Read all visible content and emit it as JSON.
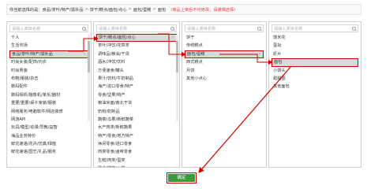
{
  "breadcrumb": {
    "prefix": "你当前选择的是：",
    "path": [
      "食品/茶叶/特产/滋补品",
      "饼干/糕点/面包/点心",
      "面包/蛋糕",
      "面包"
    ],
    "separator": ">",
    "hint": "（商品上架后不可修改，请谨慎选择）"
  },
  "columns": [
    {
      "placeholder": "请输入类目名称",
      "items": [
        {
          "label": "个人",
          "arrow": false
        },
        {
          "label": "生活市场",
          "arrow": false
        },
        {
          "label": "食品/茶叶/特产/滋补品",
          "arrow": true,
          "selected": true
        },
        {
          "label": "时尚女装/配饰/内衣",
          "arrow": false
        },
        {
          "label": "时尚男装",
          "arrow": false
        },
        {
          "label": "布鞋/服装/杂志",
          "arrow": false
        },
        {
          "label": "数码配件",
          "arrow": false
        },
        {
          "label": "数码相机/摄像机/单反/器材",
          "arrow": false
        },
        {
          "label": "重要/重要/桌子家装/服装",
          "arrow": false
        },
        {
          "label": "网络服务/电脑软件/网店装修",
          "arrow": false
        },
        {
          "label": "网游API",
          "arrow": false
        },
        {
          "label": "玩具/模型/动漫/早教/益智",
          "arrow": false
        },
        {
          "label": "海品业务特价",
          "arrow": false
        },
        {
          "label": "鲜花速递/花卉/仿真/绿植",
          "arrow": false
        },
        {
          "label": "鲜花速递/园艺/礼品/服务",
          "arrow": false
        }
      ]
    },
    {
      "placeholder": "请输入类目名称",
      "items": [
        {
          "label": "饼干/糕点/面包/点心",
          "arrow": true,
          "selected": true
        },
        {
          "label": "茶叶/冲饮/花草茶",
          "arrow": false
        },
        {
          "label": "调味品/粮油/干货",
          "arrow": false
        },
        {
          "label": "酒水/冲饮/饮料",
          "arrow": false
        },
        {
          "label": "方便速食/罐头",
          "arrow": false
        },
        {
          "label": "果汁/饮料/牛奶制品",
          "arrow": false
        },
        {
          "label": "海产/进口零食/特产",
          "arrow": false
        },
        {
          "label": "零食/坚果/特产",
          "arrow": false
        },
        {
          "label": "粮油米面/南北干货",
          "arrow": false
        },
        {
          "label": "奶粉/奶制品",
          "arrow": false
        },
        {
          "label": "蔬菜/瓜果/新鲜蔬菜",
          "arrow": false
        },
        {
          "label": "水产肉类/新鲜蔬果",
          "arrow": false
        },
        {
          "label": "特产/零食/地方特产",
          "arrow": false
        },
        {
          "label": "休闲零食/进口零食",
          "arrow": false
        },
        {
          "label": "肉类零食/卤味零食",
          "arrow": false
        },
        {
          "label": "生鲜/肉类/蛋类",
          "arrow": false
        },
        {
          "label": "熟食/腊肉/火腿",
          "arrow": false
        }
      ]
    },
    {
      "placeholder": "请输入类目名称",
      "items": [
        {
          "label": "饼干",
          "arrow": false
        },
        {
          "label": "传统糕点",
          "arrow": false
        },
        {
          "label": "面包/蛋糕",
          "arrow": true,
          "selected": true
        },
        {
          "label": "西式糕点",
          "arrow": false
        },
        {
          "label": "月饼",
          "arrow": false
        },
        {
          "label": "其他小点心",
          "arrow": false
        }
      ]
    },
    {
      "placeholder": "请输入类目名称",
      "items": [
        {
          "label": "馒米花",
          "arrow": false
        },
        {
          "label": "蛋挞",
          "arrow": false
        },
        {
          "label": "虾片",
          "arrow": false
        },
        {
          "label": "面包",
          "arrow": false,
          "selected": true
        },
        {
          "label": "小馒头",
          "arrow": false
        },
        {
          "label": "甜甜圈",
          "arrow": false
        },
        {
          "label": "其他面包",
          "arrow": false
        }
      ]
    }
  ],
  "confirm_label": "确定",
  "colors": {
    "highlight": "#d00000",
    "button": "#3c9a3c"
  }
}
